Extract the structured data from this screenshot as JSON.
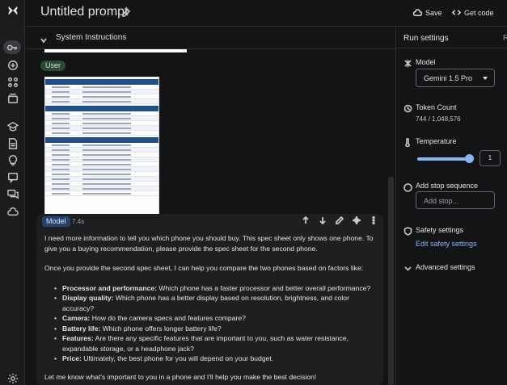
{
  "header": {
    "title": "Untitled prompt",
    "save_label": "Save",
    "get_code_label": "Get code"
  },
  "system_instructions": {
    "label": "System Instructions"
  },
  "conversation": {
    "user_role": "User",
    "model_role": "Model",
    "model_time": "7.4s",
    "intro": "I need more information to tell you which phone you should buy. This spec sheet only shows one phone. To give you a buying recommendation, please provide the spec sheet for the second phone.",
    "compare_intro": "Once you provide the second spec sheet, I can help you compare the two phones based on factors like:",
    "factors": [
      {
        "term": "Processor and performance:",
        "text": " Which phone has a faster processor and better overall performance?"
      },
      {
        "term": "Display quality:",
        "text": " Which phone has a better display based on resolution, brightness, and color accuracy?"
      },
      {
        "term": "Camera:",
        "text": " How do the camera specs and features compare?"
      },
      {
        "term": "Battery life:",
        "text": " Which phone offers longer battery life?"
      },
      {
        "term": "Features:",
        "text": " Are there any specific features that are important to you, such as water resistance, expandable storage, or a headphone jack?"
      },
      {
        "term": "Price:",
        "text": " Ultimately, the best phone for you will depend on your budget."
      }
    ],
    "closing": "Let me know what's important to you in a phone and I'll help you make the best decision!"
  },
  "run_settings": {
    "title": "Run settings",
    "title_cut": "R",
    "model_label": "Model",
    "model_value": "Gemini 1.5 Pro",
    "token_count_label": "Token Count",
    "token_count_value": "744 / 1,048,576",
    "temperature_label": "Temperature",
    "temperature_value": "1",
    "temperature_fraction": 1.0,
    "stop_sequence_label": "Add stop sequence",
    "stop_sequence_placeholder": "Add stop...",
    "safety_label": "Safety settings",
    "safety_link": "Edit safety settings",
    "advanced_label": "Advanced settings"
  },
  "icons": {
    "rail": [
      "key-icon",
      "add-icon",
      "grid-icon",
      "library-icon",
      "school-icon",
      "document-icon",
      "lightbulb-icon",
      "chat-icon",
      "forum-icon",
      "cloud-icon",
      "settings-icon"
    ],
    "accent": "#8ab4f8"
  }
}
